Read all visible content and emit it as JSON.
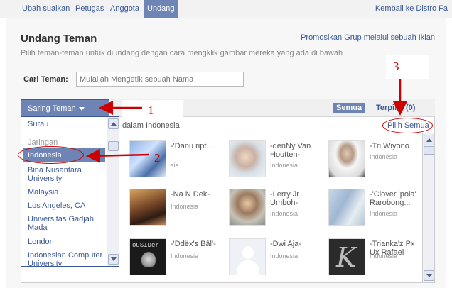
{
  "nav": {
    "items": [
      "Ubah suaikan",
      "Petugas",
      "Anggota",
      "Undang"
    ],
    "back": "Kembali ke Distro Fa"
  },
  "header": {
    "title": "Undang Teman",
    "promo": "Promosikan Grup melalui sebuah Iklan",
    "subtitle": "Pilih teman-teman untuk diundang dengan cara mengklik gambar mereka yang ada di bawah"
  },
  "search": {
    "label": "Cari Teman:",
    "placeholder": "Mulailah Mengetik sebuah Nama"
  },
  "toolbar": {
    "filter_label": "Saring Teman",
    "semua": "Semua",
    "terpilih": "Terpilih (0)",
    "dalam": "dalam Indonesia",
    "pilih_semua": "Pilih Semua"
  },
  "dropdown": {
    "top_item": "Surau",
    "header": "Jaringan",
    "items": [
      "Indonesia",
      "Bina Nusantara University",
      "Malaysia",
      "Los Angeles, CA",
      "Universitas Gadjah Mada",
      "London",
      "Indonesian Computer University"
    ]
  },
  "friends": [
    {
      "name": "-'Danu   ript...",
      "loc": "sia"
    },
    {
      "name": "-denNy Van Houtten-",
      "loc": "Indonesia"
    },
    {
      "name": "-Tri Wiyono",
      "loc": "Indonesia"
    },
    {
      "name": "-Na N Dek-",
      "loc": "Indonesia"
    },
    {
      "name": "-Lerry Jr Umboh-",
      "loc": "Indonesia"
    },
    {
      "name": "-'Clover 'pola' Rarobong...",
      "loc": "Indonesia"
    },
    {
      "name": "-'Ddëx's Bâl'-",
      "loc": "Indonesia"
    },
    {
      "name": "-Dwi Aja-",
      "loc": "Indonesia"
    },
    {
      "name": "-Trianka'z Px Ux Rafael",
      "loc": "Indonesia"
    }
  ],
  "avatar_texts": {
    "ouisider": "ouSIDer"
  },
  "annotations": {
    "one": "1",
    "two": "2",
    "three": "3"
  },
  "colors": {
    "brand": "#3b5998",
    "nav_active": "#6d84b4",
    "annotation": "#cc0000"
  }
}
